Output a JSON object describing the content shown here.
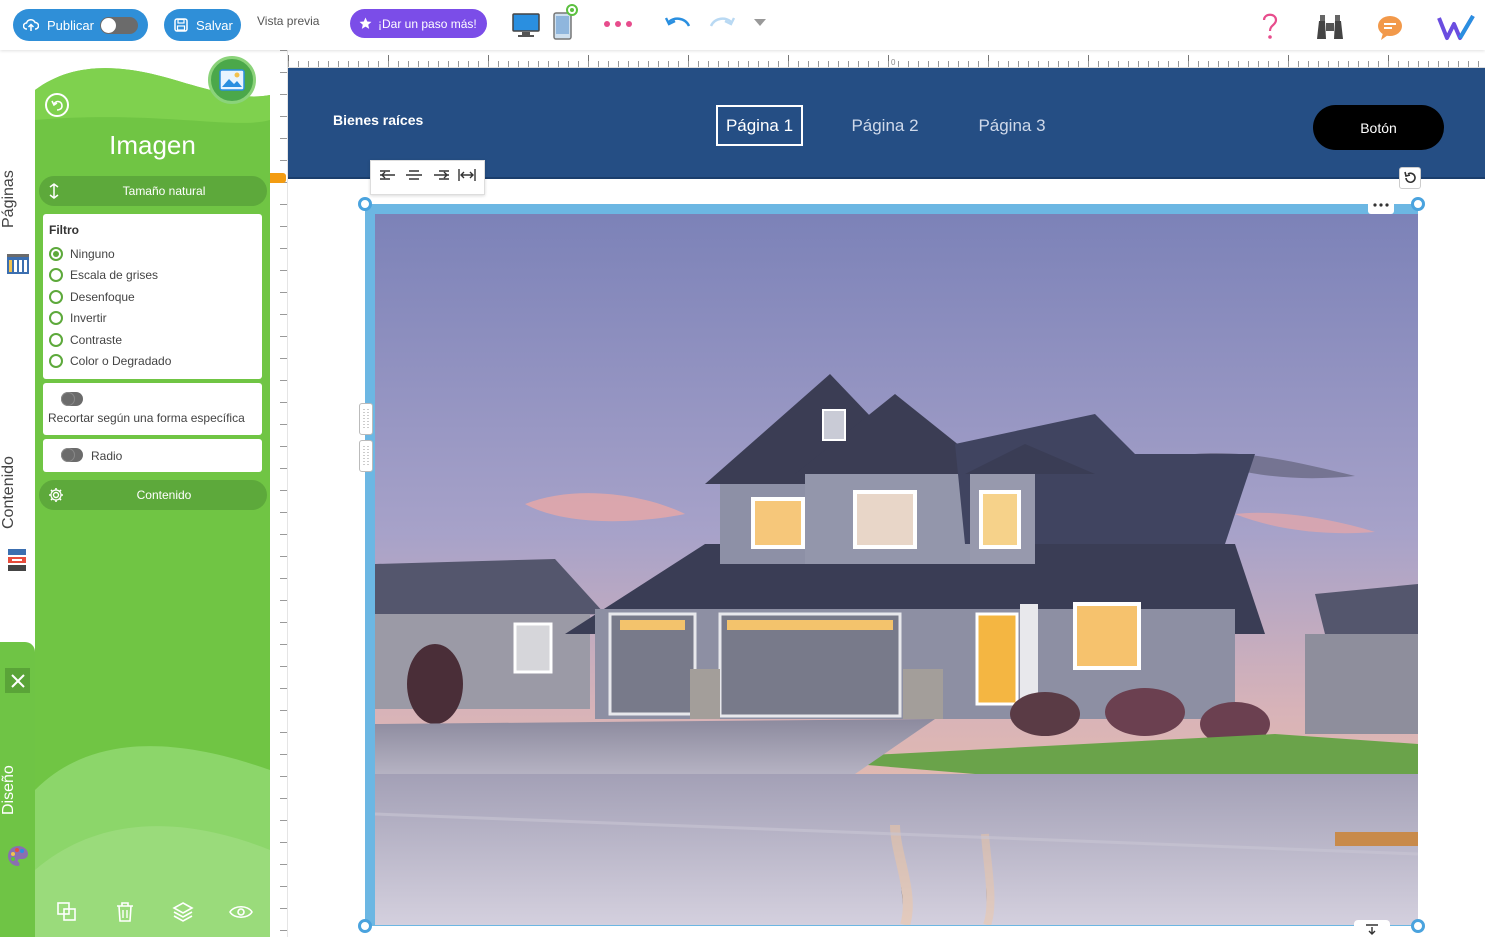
{
  "toolbar": {
    "publish_label": "Publicar",
    "save_label": "Salvar",
    "preview_label": "Vista previa",
    "upgrade_label": "¡Dar un paso más!",
    "icons": [
      "upload-cloud-icon",
      "save-icon",
      "star-icon",
      "desktop-icon",
      "mobile-icon",
      "more-dots-icon",
      "undo-icon",
      "redo-icon",
      "dropdown-caret-icon",
      "help-icon",
      "binoculars-icon",
      "chat-icon",
      "w-logo-icon"
    ]
  },
  "ruler": {
    "zero_label": "0"
  },
  "rail": {
    "pages_label": "Páginas",
    "content_label": "Contenido",
    "design_label": "Diseño"
  },
  "panel": {
    "title": "Imagen",
    "natural_size_label": "Tamaño natural",
    "filter": {
      "title": "Filtro",
      "options": [
        {
          "label": "Ninguno",
          "selected": true
        },
        {
          "label": "Escala de grises",
          "selected": false
        },
        {
          "label": "Desenfoque",
          "selected": false
        },
        {
          "label": "Invertir",
          "selected": false
        },
        {
          "label": "Contraste",
          "selected": false
        },
        {
          "label": "Color o Degradado",
          "selected": false
        }
      ]
    },
    "crop_label": "Recortar según una forma específica",
    "radius_label": "Radio",
    "content_label": "Contenido"
  },
  "site": {
    "brand": "Bienes raíces",
    "nav": [
      "Página 1",
      "Página 2",
      "Página 3"
    ],
    "button_label": "Botón"
  },
  "colors": {
    "toolbar_blue": "#2f8fd8",
    "upgrade_purple": "#7b4de8",
    "panel_green": "#70c544",
    "header_blue": "#254e84",
    "selection_blue": "#6cb7e3"
  }
}
